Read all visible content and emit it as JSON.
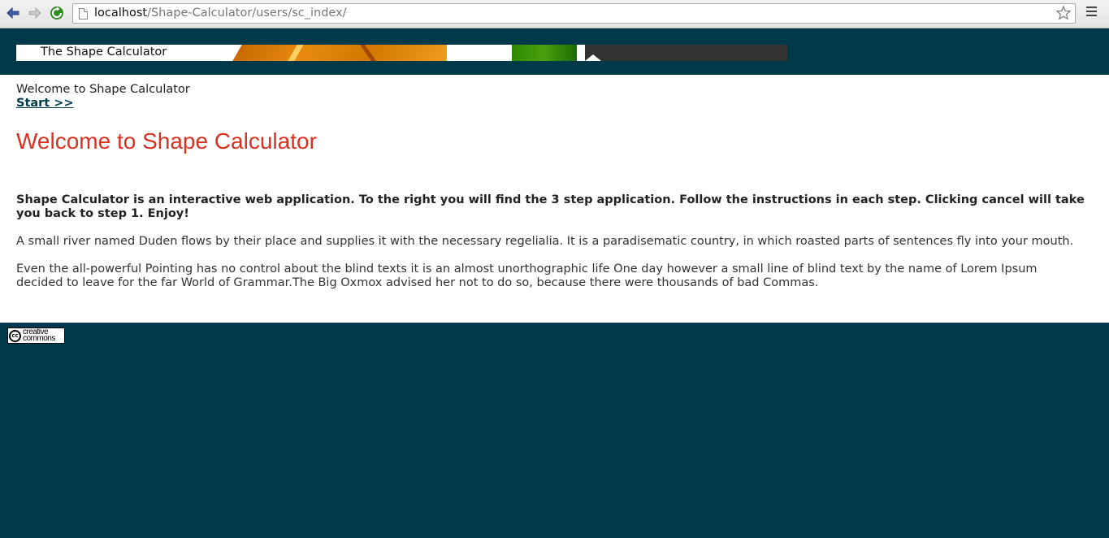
{
  "browser": {
    "url_host": "localhost",
    "url_path": "/Shape-Calculator/users/sc_index/"
  },
  "header": {
    "banner_title": "The Shape Calculator"
  },
  "content": {
    "welcome_small": "Welcome to Shape Calculator",
    "start_link": "Start >>",
    "page_title": "Welcome to Shape Calculator",
    "intro": "Shape Calculator is an interactive web application. To the right you will find the 3 step application. Follow the instructions in each step. Clicking cancel will take you back to step 1. Enjoy!",
    "para1": "A small river named Duden flows by their place and supplies it with the necessary regelialia. It is a paradisematic country, in which roasted parts of sentences fly into your mouth.",
    "para2": "Even the all-powerful Pointing has no control about the blind texts it is an almost unorthographic life One day however a small line of blind text by the name of Lorem Ipsum decided to leave for the far World of Grammar.The Big Oxmox advised her not to do so, because there were thousands of bad Commas."
  },
  "footer": {
    "cc_symbol": "cc",
    "cc_text_line1": "creative",
    "cc_text_line2": "commons"
  },
  "colors": {
    "brand_dark": "#003a4a",
    "title_red": "#d83222"
  }
}
